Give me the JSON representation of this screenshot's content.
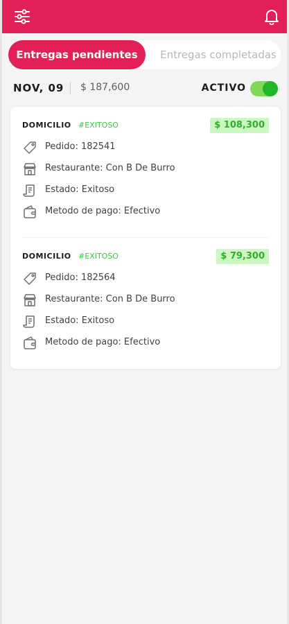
{
  "header": {
    "filter_icon": "sliders-icon",
    "bell_icon": "bell-icon",
    "brand_color": "#e21f56"
  },
  "tabs": [
    {
      "label": "Entregas pendientes",
      "active": true
    },
    {
      "label": "Entregas completadas",
      "active": false
    }
  ],
  "summary": {
    "date": "NOV, 09",
    "total": "$ 187,600",
    "status_label": "ACTIVO",
    "toggle_on": true
  },
  "orders": [
    {
      "type": "DOMICILIO",
      "tag": "#EXITOSO",
      "amount": "$ 108,300",
      "pedido": "Pedido: 182541",
      "restaurante": "Restaurante: Con B De Burro",
      "estado": "Estado: Exitoso",
      "metodo": "Metodo de pago: Efectivo"
    },
    {
      "type": "DOMICILIO",
      "tag": "#EXITOSO",
      "amount": "$ 79,300",
      "pedido": "Pedido: 182564",
      "restaurante": "Restaurante: Con B De Burro",
      "estado": "Estado: Exitoso",
      "metodo": "Metodo de pago: Efectivo"
    }
  ]
}
